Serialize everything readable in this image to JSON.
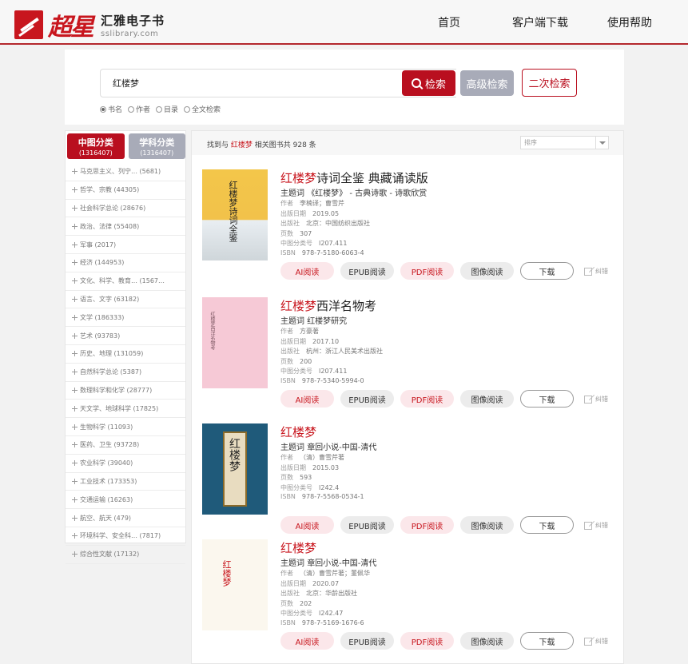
{
  "header": {
    "logo_cn": "超星",
    "title": "汇雅电子书",
    "url": "sslibrary.com",
    "nav": [
      "首页",
      "客户端下载",
      "使用帮助"
    ]
  },
  "search": {
    "query": "红楼梦",
    "search_label": "检索",
    "advanced_label": "高级检索",
    "secondary_label": "二次检索",
    "options": [
      "书名",
      "作者",
      "目录",
      "全文检索"
    ],
    "selected_option": "书名"
  },
  "sidebar": {
    "tabs": [
      {
        "label": "中图分类",
        "count": "(1316407)"
      },
      {
        "label": "学科分类",
        "count": "(1316407)"
      }
    ],
    "items": [
      "马克思主义、列宁… (5681)",
      "哲学、宗教 (44305)",
      "社会科学总论 (28676)",
      "政治、法律 (55408)",
      "军事 (2017)",
      "经济 (144953)",
      "文化、科学、教育… (1567…",
      "语言、文字 (63182)",
      "文学 (186333)",
      "艺术 (93783)",
      "历史、地理 (131059)",
      "自然科学总论 (5387)",
      "数理科学和化学 (28777)",
      "天文学、地球科学 (17825)",
      "生物科学 (11093)",
      "医药、卫生 (93728)",
      "农业科学 (39040)",
      "工业技术 (173353)",
      "交通运输 (16263)",
      "航空、航天 (479)",
      "环境科学、安全科… (7817)",
      "综合性文献 (17132)"
    ]
  },
  "results": {
    "summary_prefix": "找到与",
    "keyword": "红楼梦",
    "summary_suffix": "相关图书共 928 条",
    "sort_placeholder": "排序",
    "labels": {
      "subject": "主题词",
      "author": "作者",
      "date": "出版日期",
      "publisher": "出版社",
      "pages": "页数",
      "class": "中图分类号",
      "isbn": "ISBN"
    },
    "buttons": {
      "ai": "AI阅读",
      "epub": "EPUB阅读",
      "pdf": "PDF阅读",
      "image": "图像阅读",
      "download": "下载",
      "report": "纠错"
    },
    "books": [
      {
        "title_kw": "红楼梦",
        "title_rest": "诗词全鉴 典藏诵读版",
        "subject": "《红楼梦》 - 古典诗歌 - 诗歌欣赏",
        "author": "李楠译；曹雪芹",
        "date": "2019.05",
        "publisher": "北京：中国纺织出版社",
        "pages": "307",
        "class": "I207.411",
        "isbn": "978-7-5180-6063-4",
        "cover_text": "红楼梦诗词全鉴",
        "has_publisher": true
      },
      {
        "title_kw": "红楼梦",
        "title_rest": "西洋名物考",
        "subject": "红楼梦研究",
        "author": "方豪著",
        "date": "2017.10",
        "publisher": "杭州：浙江人民美术出版社",
        "pages": "200",
        "class": "I207.411",
        "isbn": "978-7-5340-5994-0",
        "cover_text": "红楼梦西洋名物考",
        "has_publisher": true
      },
      {
        "title_kw": "红楼梦",
        "title_rest": "",
        "subject": "章回小说-中国-清代",
        "author": "（清）曹雪芹著",
        "date": "2015.03",
        "publisher": "",
        "pages": "593",
        "class": "I242.4",
        "isbn": "978-7-5568-0534-1",
        "cover_text": "红楼梦",
        "has_publisher": false
      },
      {
        "title_kw": "红楼梦",
        "title_rest": "",
        "subject": "章回小说-中国-清代",
        "author": "（清）曹雪芹著；董佩华",
        "date": "2020.07",
        "publisher": "北京：华龄出版社",
        "pages": "202",
        "class": "I242.47",
        "isbn": "978-7-5169-1676-6",
        "cover_text": "红楼梦",
        "has_publisher": true
      }
    ]
  },
  "colors": {
    "brand_red": "#b90f1f",
    "gray_button": "#a8abb8",
    "keyword_red": "#c8161e"
  }
}
